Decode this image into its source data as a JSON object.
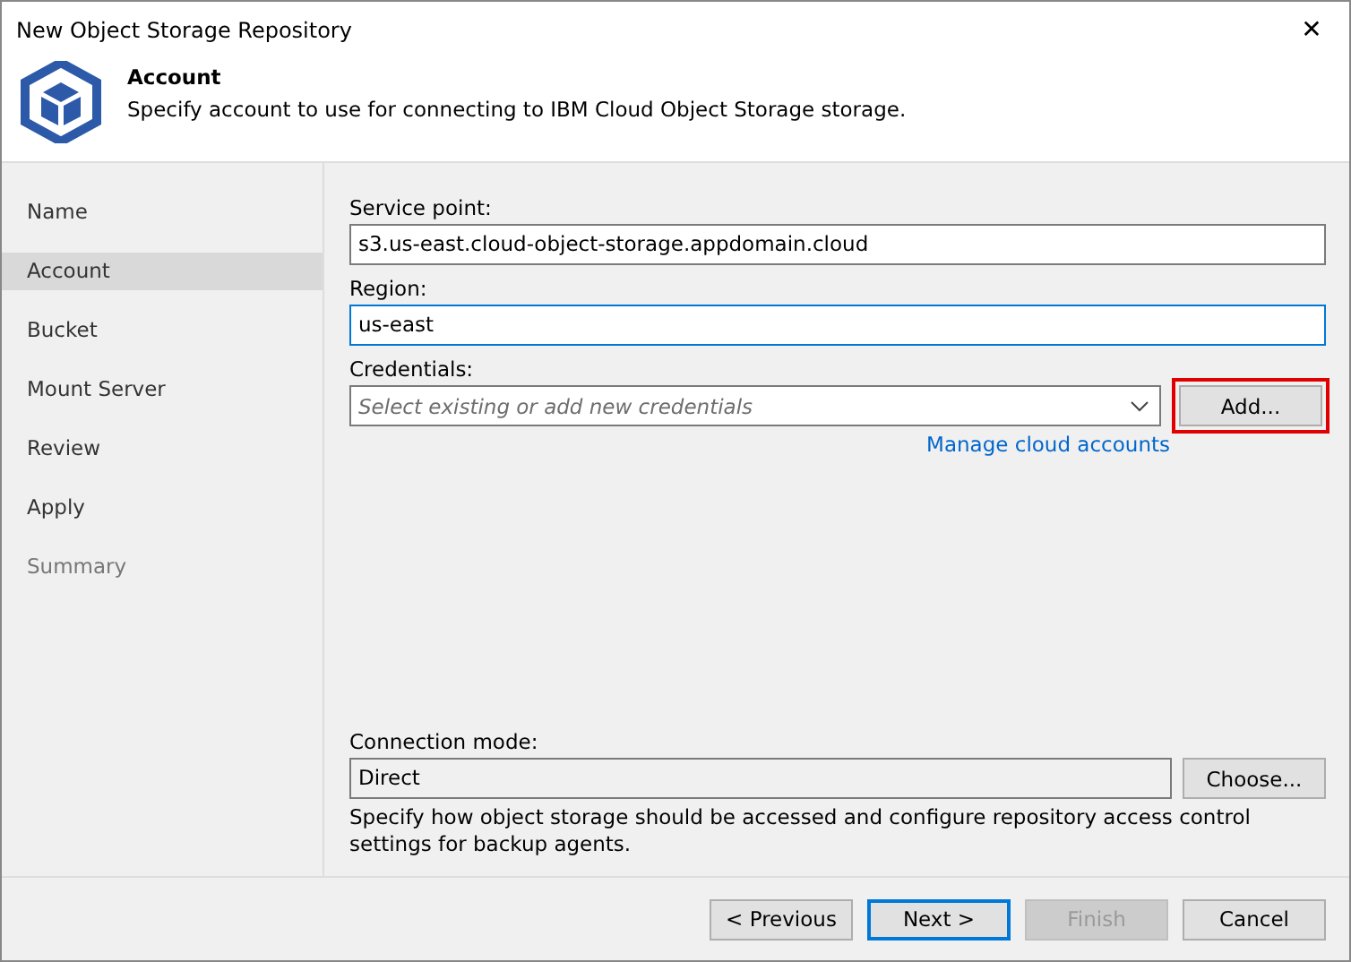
{
  "window": {
    "title": "New Object Storage Repository",
    "close": "✕"
  },
  "header": {
    "title": "Account",
    "description": "Specify account to use for connecting to IBM Cloud Object Storage storage."
  },
  "sidebar": {
    "items": [
      {
        "label": "Name",
        "selected": false,
        "disabled": false
      },
      {
        "label": "Account",
        "selected": true,
        "disabled": false
      },
      {
        "label": "Bucket",
        "selected": false,
        "disabled": false
      },
      {
        "label": "Mount Server",
        "selected": false,
        "disabled": false
      },
      {
        "label": "Review",
        "selected": false,
        "disabled": false
      },
      {
        "label": "Apply",
        "selected": false,
        "disabled": false
      },
      {
        "label": "Summary",
        "selected": false,
        "disabled": true
      }
    ]
  },
  "form": {
    "service_point": {
      "label": "Service point:",
      "value": "s3.us-east.cloud-object-storage.appdomain.cloud",
      "focused": false
    },
    "region": {
      "label": "Region:",
      "value": "us-east",
      "focused": true
    },
    "credentials": {
      "label": "Credentials:",
      "placeholder": "Select existing or add new credentials",
      "add_button": {
        "label": "Add...",
        "highlighted": true
      },
      "link": "Manage cloud accounts"
    },
    "connection_mode": {
      "label": "Connection mode:",
      "value": "Direct",
      "button": "Choose...",
      "description": "Specify how object storage should be accessed and configure repository access control settings for backup agents."
    }
  },
  "buttons": [
    {
      "label": "< Previous",
      "default": false,
      "disabled": false
    },
    {
      "label": "Next >",
      "default": true,
      "disabled": false
    },
    {
      "label": "Finish",
      "default": false,
      "disabled": true
    },
    {
      "label": "Cancel",
      "default": false,
      "disabled": false
    }
  ]
}
